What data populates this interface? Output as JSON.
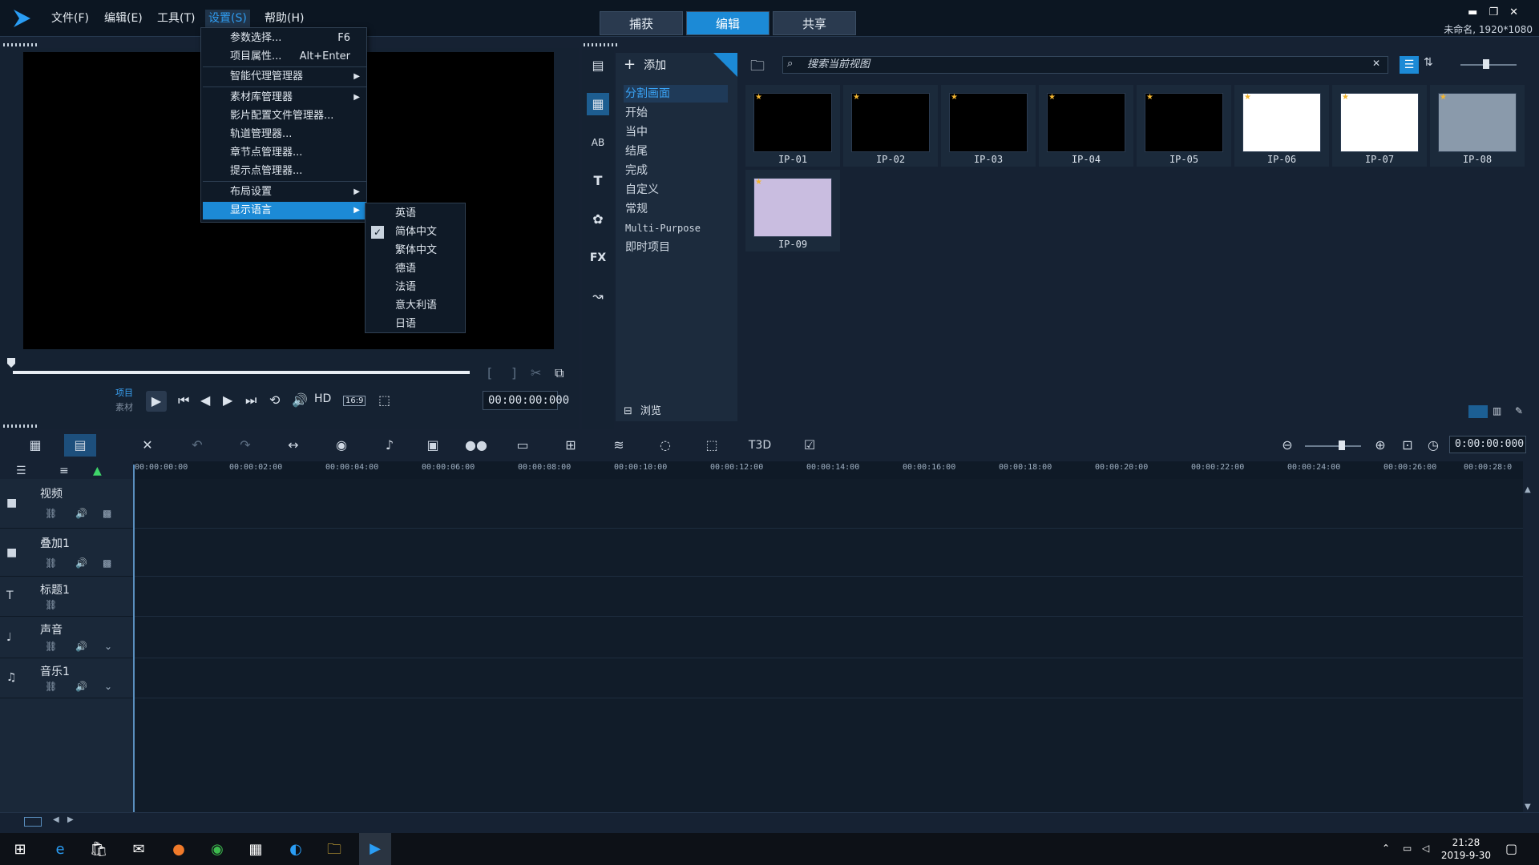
{
  "menubar": {
    "file": "文件(F)",
    "edit": "编辑(E)",
    "tools": "工具(T)",
    "settings": "设置(S)",
    "help": "帮助(H)"
  },
  "tabs": {
    "capture": "捕获",
    "edit": "编辑",
    "share": "共享"
  },
  "window": {
    "info": "未命名, 1920*1080"
  },
  "settings_menu": {
    "items": [
      {
        "label": "参数选择...",
        "shortcut": "F6"
      },
      {
        "label": "项目属性...",
        "shortcut": "Alt+Enter"
      },
      {
        "label": "智能代理管理器"
      },
      {
        "label": "素材库管理器"
      },
      {
        "label": "影片配置文件管理器..."
      },
      {
        "label": "轨道管理器..."
      },
      {
        "label": "章节点管理器..."
      },
      {
        "label": "提示点管理器..."
      },
      {
        "label": "布局设置"
      },
      {
        "label": "显示语言"
      }
    ]
  },
  "language_menu": {
    "items": [
      "英语",
      "简体中文",
      "繁体中文",
      "德语",
      "法语",
      "意大利语",
      "日语"
    ],
    "checked": "简体中文"
  },
  "player": {
    "project_label": "项目",
    "clip_label": "素材",
    "aspect": "16:9",
    "hd": "HD",
    "timecode": "00:00:00:000"
  },
  "library": {
    "add_label": "添加",
    "search_placeholder": "搜索当前视图",
    "categories": [
      "分割画面",
      "开始",
      "当中",
      "结尾",
      "完成",
      "自定义",
      "常规",
      "Multi-Purpose",
      "即时项目"
    ],
    "active_category": "分割画面",
    "browse_label": "浏览",
    "thumbnails": [
      {
        "label": "IP-01"
      },
      {
        "label": "IP-02"
      },
      {
        "label": "IP-03"
      },
      {
        "label": "IP-04"
      },
      {
        "label": "IP-05"
      },
      {
        "label": "IP-06"
      },
      {
        "label": "IP-07"
      },
      {
        "label": "IP-08"
      },
      {
        "label": "IP-09"
      }
    ]
  },
  "timeline": {
    "timecode": "0:00:00:000",
    "ruler_ticks": [
      "00:00:00:00",
      "00:00:02:00",
      "00:00:04:00",
      "00:00:06:00",
      "00:00:08:00",
      "00:00:10:00",
      "00:00:12:00",
      "00:00:14:00",
      "00:00:16:00",
      "00:00:18:00",
      "00:00:20:00",
      "00:00:22:00",
      "00:00:24:00",
      "00:00:26:00",
      "00:00:28:0"
    ],
    "tracks": [
      "视频",
      "叠加1",
      "标题1",
      "声音",
      "音乐1"
    ]
  },
  "taskbar": {
    "time": "21:28",
    "date": "2019-9-30"
  }
}
